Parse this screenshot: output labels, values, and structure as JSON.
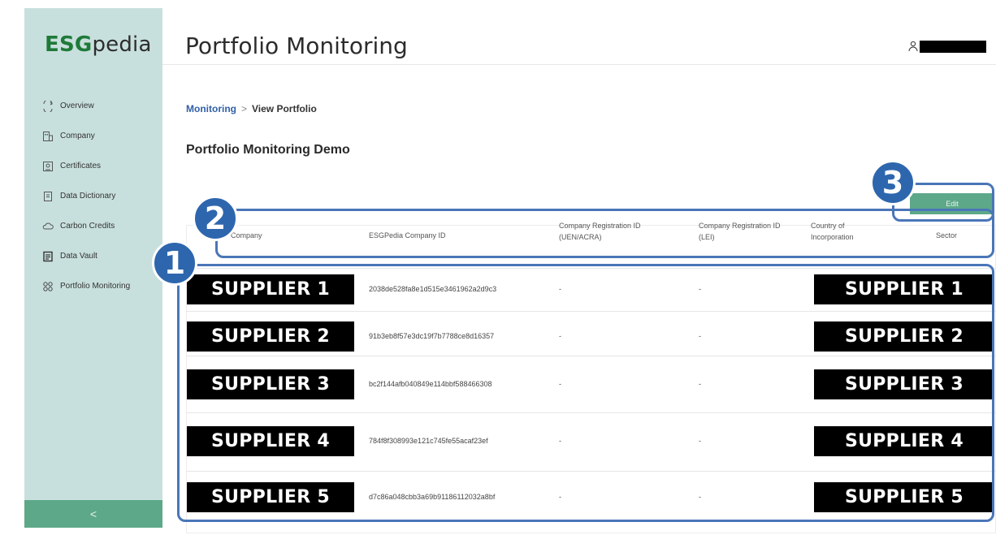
{
  "logo": {
    "bold": "ESG",
    "light": "pedia"
  },
  "sidebar": {
    "items": [
      {
        "label": "Overview",
        "icon": "overview-icon"
      },
      {
        "label": "Company",
        "icon": "company-icon"
      },
      {
        "label": "Certificates",
        "icon": "certificate-icon"
      },
      {
        "label": "Data Dictionary",
        "icon": "book-icon"
      },
      {
        "label": "Carbon Credits",
        "icon": "cloud-icon"
      },
      {
        "label": "Data Vault",
        "icon": "vault-icon"
      },
      {
        "label": "Portfolio Monitoring",
        "icon": "portfolio-icon"
      }
    ],
    "collapse_glyph": "<"
  },
  "header": {
    "title": "Portfolio Monitoring"
  },
  "breadcrumb": {
    "link": "Monitoring",
    "separator": ">",
    "current": "View Portfolio"
  },
  "portfolio": {
    "title": "Portfolio Monitoring Demo",
    "edit_label": "Edit"
  },
  "table": {
    "headers": [
      "Company",
      "ESGPedia Company ID",
      "Company Registration ID (UEN/ACRA)",
      "Company Registration ID (LEI)",
      "Country of Incorporation",
      "Sector"
    ],
    "rows": [
      {
        "company": "SUPPLIER 1",
        "id": "2038de528fa8e1d515e3461962a2d9c3",
        "uen": "-",
        "lei": "-",
        "sector_label": "SUPPLIER 1"
      },
      {
        "company": "SUPPLIER 2",
        "id": "91b3eb8f57e3dc19f7b7788ce8d16357",
        "uen": "-",
        "lei": "-",
        "sector_label": "SUPPLIER 2"
      },
      {
        "company": "SUPPLIER 3",
        "id": "bc2f144afb040849e114bbf588466308",
        "uen": "-",
        "lei": "-",
        "sector_label": "SUPPLIER 3"
      },
      {
        "company": "SUPPLIER 4",
        "id": "784f8f308993e121c745fe55acaf23ef",
        "uen": "-",
        "lei": "-",
        "sector_label": "SUPPLIER 4"
      },
      {
        "company": "SUPPLIER 5",
        "id": "d7c86a048cbb3a69b91186112032a8bf",
        "uen": "-",
        "lei": "-",
        "sector_label": "SUPPLIER 5"
      }
    ]
  },
  "annotations": {
    "badge_1": "1",
    "badge_2": "2",
    "badge_3": "3",
    "color": "#2e66ae"
  }
}
